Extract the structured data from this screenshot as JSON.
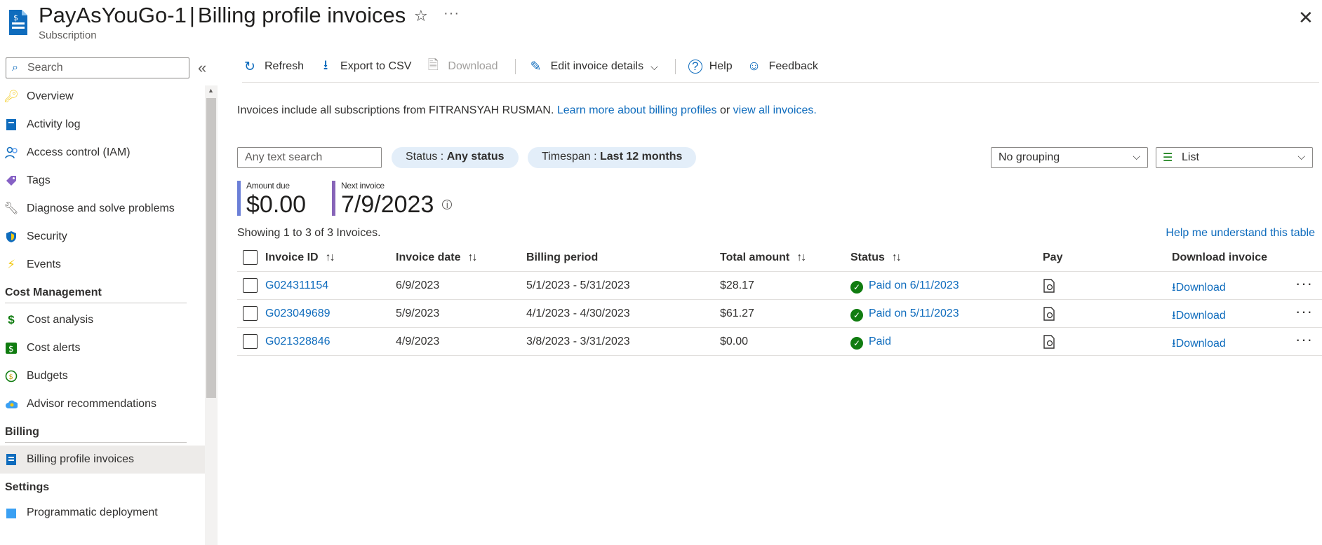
{
  "header": {
    "resource_name": "PayAsYouGo-1",
    "separator": "|",
    "page_title": "Billing profile invoices",
    "subtitle": "Subscription",
    "favorite_icon": "star-icon",
    "more_icon": "more-icon",
    "close_icon": "close-icon"
  },
  "sidebar": {
    "search_placeholder": "Search",
    "items": [
      {
        "label": "Overview",
        "icon": "key-icon"
      },
      {
        "label": "Activity log",
        "icon": "activity-log-icon"
      },
      {
        "label": "Access control (IAM)",
        "icon": "people-icon"
      },
      {
        "label": "Tags",
        "icon": "tag-icon"
      },
      {
        "label": "Diagnose and solve problems",
        "icon": "wrench-icon"
      },
      {
        "label": "Security",
        "icon": "shield-icon"
      },
      {
        "label": "Events",
        "icon": "lightning-icon"
      }
    ],
    "sections": [
      {
        "title": "Cost Management",
        "items": [
          {
            "label": "Cost analysis",
            "icon": "cost-analysis-icon"
          },
          {
            "label": "Cost alerts",
            "icon": "cost-alert-icon"
          },
          {
            "label": "Budgets",
            "icon": "budget-icon"
          },
          {
            "label": "Advisor recommendations",
            "icon": "cloud-advisor-icon"
          }
        ]
      },
      {
        "title": "Billing",
        "items": [
          {
            "label": "Billing profile invoices",
            "icon": "invoice-icon",
            "active": true
          }
        ]
      },
      {
        "title": "Settings",
        "items": [
          {
            "label": "Programmatic deployment",
            "icon": "deployment-icon"
          }
        ]
      }
    ]
  },
  "toolbar": {
    "refresh": "Refresh",
    "export": "Export to CSV",
    "download": "Download",
    "edit": "Edit invoice details",
    "help": "Help",
    "feedback": "Feedback"
  },
  "info": {
    "text": "Invoices include all subscriptions from FITRANSYAH RUSMAN.",
    "link1": "Learn more about billing profiles",
    "or": "or",
    "link2": "view all invoices."
  },
  "filters": {
    "text_placeholder": "Any text search",
    "status_label": "Status :",
    "status_value": "Any status",
    "timespan_label": "Timespan :",
    "timespan_value": "Last 12 months",
    "grouping": "No grouping",
    "view": "List"
  },
  "kpis": {
    "amount_due_label": "Amount due",
    "amount_due_value": "$0.00",
    "next_invoice_label": "Next invoice",
    "next_invoice_value": "7/9/2023"
  },
  "table": {
    "showing": "Showing 1 to 3 of 3 Invoices.",
    "help_link": "Help me understand this table",
    "columns": {
      "invoice_id": "Invoice ID",
      "invoice_date": "Invoice date",
      "billing_period": "Billing period",
      "total_amount": "Total amount",
      "status": "Status",
      "pay": "Pay",
      "download": "Download invoice"
    },
    "rows": [
      {
        "id": "G024311154",
        "date": "6/9/2023",
        "period": "5/1/2023 - 5/31/2023",
        "amount": "$28.17",
        "status": "Paid on 6/11/2023",
        "download": "Download"
      },
      {
        "id": "G023049689",
        "date": "5/9/2023",
        "period": "4/1/2023 - 4/30/2023",
        "amount": "$61.27",
        "status": "Paid on 5/11/2023",
        "download": "Download"
      },
      {
        "id": "G021328846",
        "date": "4/9/2023",
        "period": "3/8/2023 - 3/31/2023",
        "amount": "$0.00",
        "status": "Paid",
        "download": "Download"
      }
    ]
  },
  "colors": {
    "link": "#0f6cbd",
    "success": "#107c10",
    "amount_bar": "#6b7fd7",
    "next_bar": "#8764b8"
  }
}
